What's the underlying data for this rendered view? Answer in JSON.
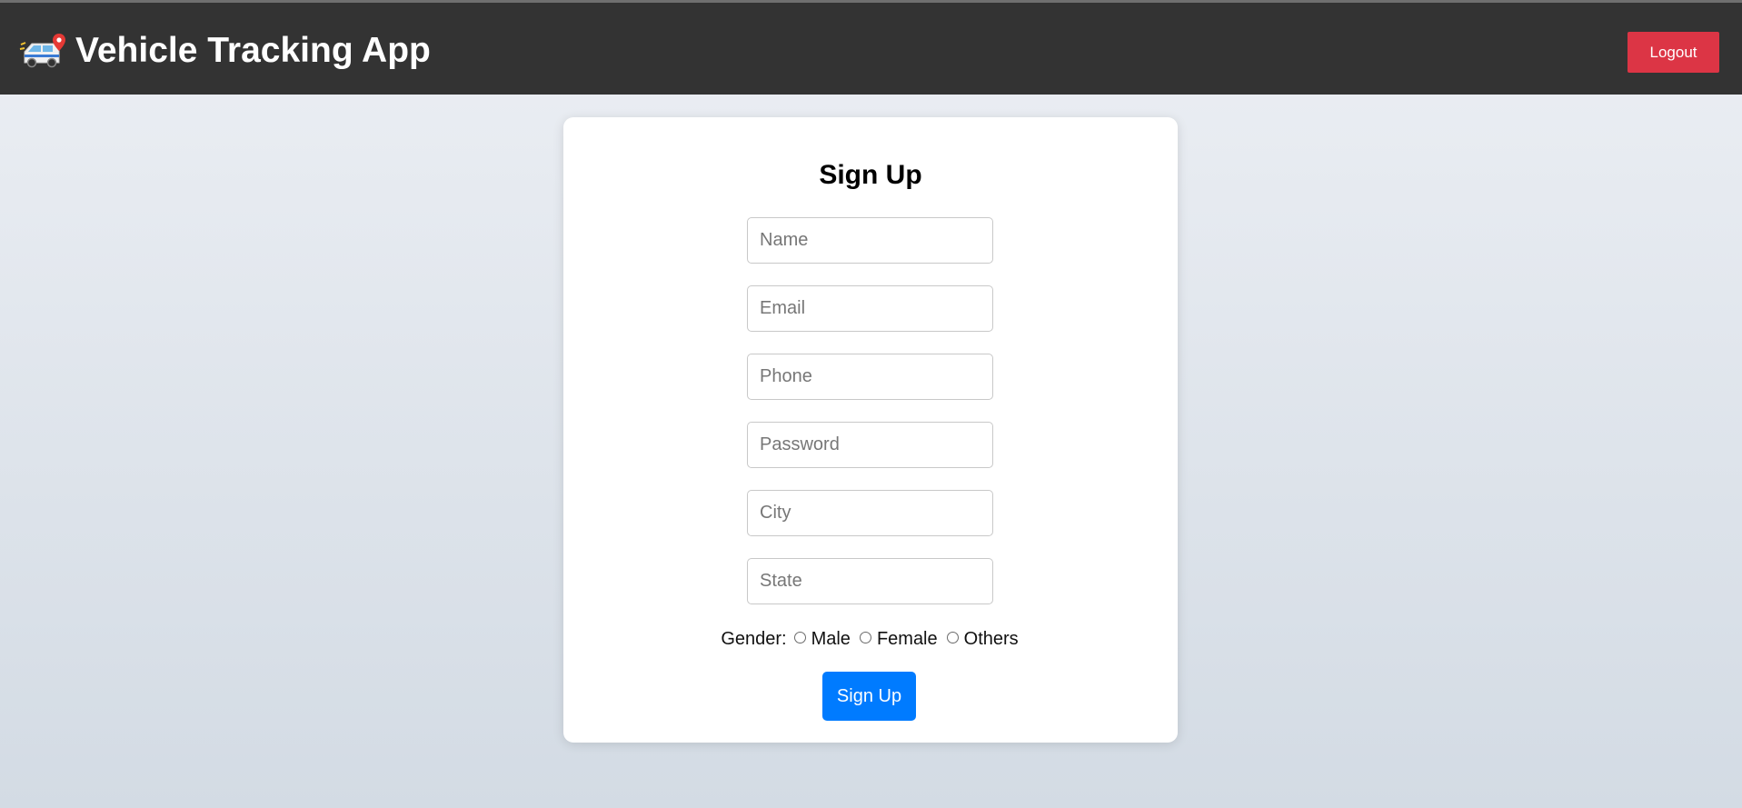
{
  "header": {
    "title": "Vehicle Tracking App",
    "logo_icon": "van-with-location-pin-icon",
    "logout_label": "Logout",
    "logout_color": "#dc3545",
    "background_color": "#333333"
  },
  "form": {
    "title": "Sign Up",
    "fields": {
      "name": {
        "placeholder": "Name",
        "value": ""
      },
      "email": {
        "placeholder": "Email",
        "value": ""
      },
      "phone": {
        "placeholder": "Phone",
        "value": ""
      },
      "password": {
        "placeholder": "Password",
        "value": ""
      },
      "city": {
        "placeholder": "City",
        "value": ""
      },
      "state": {
        "placeholder": "State",
        "value": ""
      }
    },
    "gender": {
      "label": "Gender:",
      "options": [
        "Male",
        "Female",
        "Others"
      ],
      "selected": null
    },
    "submit_label": "Sign Up",
    "submit_color": "#007bff"
  }
}
